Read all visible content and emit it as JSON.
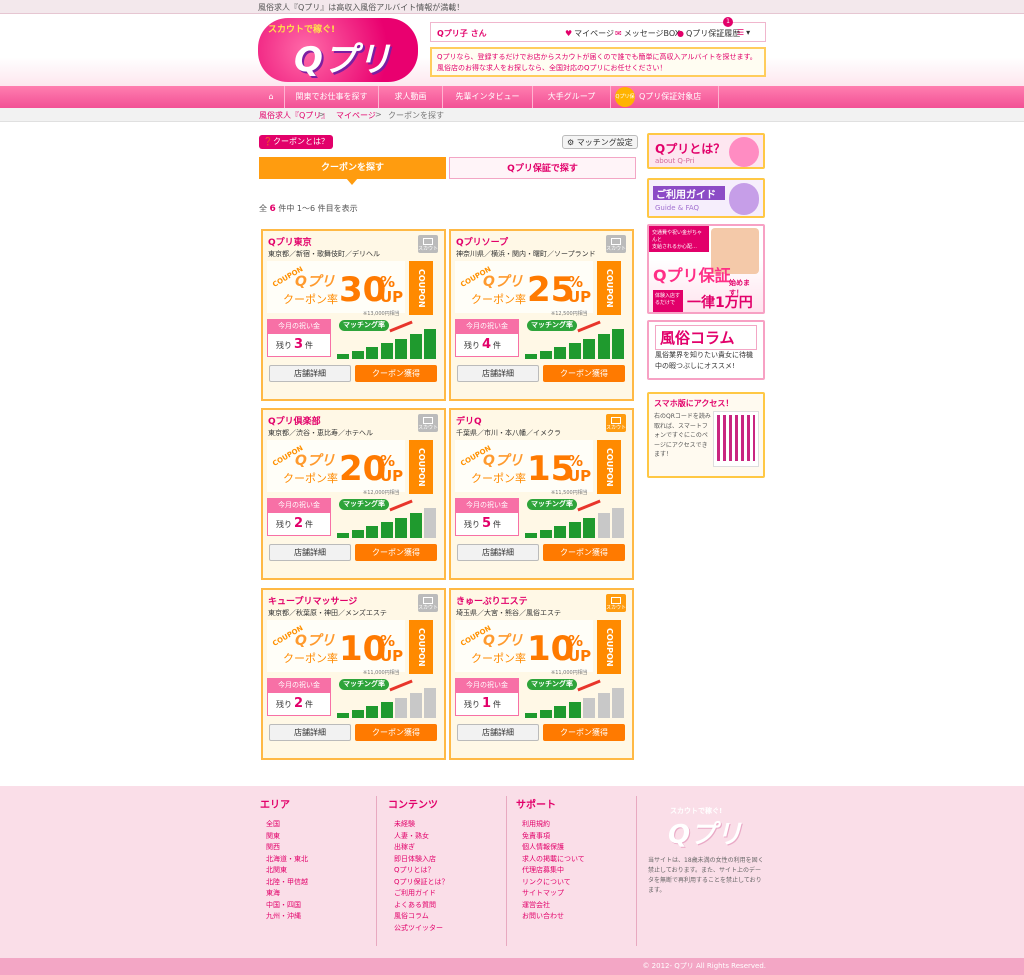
{
  "topbar": {
    "tagline": "風俗求人『Qプリ』は高収入風俗アルバイト情報が満載！"
  },
  "brand": {
    "tag": "スカウトで稼ぐ!",
    "name": "Qプリ",
    "accent": "#e2006a"
  },
  "user": {
    "name": "Qプリ子 さん",
    "links": [
      {
        "icon": "heart-icon",
        "label": "マイページ"
      },
      {
        "icon": "mail-icon",
        "label": "メッセージBOX"
      },
      {
        "icon": "lock-icon",
        "label": "Qプリ保証履歴"
      }
    ],
    "badge": "1"
  },
  "notice": "Qプリなら、登録するだけでお店からスカウトが届くので誰でも簡単に高収入アルバイトを探せます。風俗店のお得な求人をお探しなら、全国対応のQプリにお任せください！",
  "nav": {
    "home_icon": "home-icon",
    "items": [
      "関東でお仕事を探す",
      "求人動画",
      "先輩インタビュー",
      "大手グループ",
      "Qプリ保証対象店"
    ],
    "guarantee_badge": "Qプリ保証"
  },
  "breadcrumb": [
    "風俗求人『Qプリ』",
    "マイページ",
    "クーポンを探す"
  ],
  "coupon_help": "クーポンとは？",
  "matching_settings": "マッチング設定",
  "tabs": {
    "active": "クーポンを探す",
    "inactive": "Qプリ保証で探す"
  },
  "results": {
    "prefix": "全",
    "count": "6",
    "suffix": "件中 1〜6 件目を表示"
  },
  "card_labels": {
    "coupon_ribbon": "COUPON",
    "logo": "Qプリ",
    "rate_label": "クーポン率",
    "celebration": "今月の祝い金",
    "remaining": "残り",
    "unit": "件",
    "matching": "マッチング率",
    "strip": "COUPON",
    "scout": "スカウト",
    "details": "店舗詳細",
    "get": "クーポン獲得"
  },
  "cards": [
    {
      "name": "Qプリ東京",
      "area": "東京都／新宿・歌舞伎町／デリヘル",
      "rate": "30",
      "note": "※13,000円相当",
      "remaining": "3",
      "scout_active": false,
      "bars": [
        1,
        2,
        3,
        4,
        5,
        6,
        7
      ]
    },
    {
      "name": "Qプリソープ",
      "area": "神奈川県／横浜・関内・曙町／ソープランド",
      "rate": "25",
      "note": "※12,500円相当",
      "remaining": "4",
      "scout_active": false,
      "bars": [
        1,
        2,
        3,
        4,
        5,
        6,
        7
      ]
    },
    {
      "name": "Qプリ倶楽部",
      "area": "東京都／渋谷・恵比寿／ホテヘル",
      "rate": "20",
      "note": "※12,000円相当",
      "remaining": "2",
      "scout_active": false,
      "bars": [
        1,
        2,
        3,
        4,
        5,
        6,
        0
      ]
    },
    {
      "name": "デリQ",
      "area": "千葉県／市川・本八幡／イメクラ",
      "rate": "15",
      "note": "※11,500円相当",
      "remaining": "5",
      "scout_active": true,
      "bars": [
        1,
        2,
        3,
        4,
        5,
        0,
        0
      ]
    },
    {
      "name": "キュープリマッサージ",
      "area": "東京都／秋葉原・神田／メンズエステ",
      "rate": "10",
      "note": "※11,000円相当",
      "remaining": "2",
      "scout_active": false,
      "bars": [
        1,
        2,
        3,
        4,
        0,
        0,
        0
      ]
    },
    {
      "name": "きゅーぷりエステ",
      "area": "埼玉県／大宮・熊谷／風俗エステ",
      "rate": "10",
      "note": "※11,000円相当",
      "remaining": "1",
      "scout_active": true,
      "bars": [
        1,
        2,
        3,
        4,
        0,
        0,
        0
      ]
    }
  ],
  "sidebar": {
    "about": {
      "title": "Qプリとは？",
      "sub": "about Q-Pri"
    },
    "guide": {
      "title": "ご利用ガイド",
      "sub": "Guide & FAQ"
    },
    "guarantee": {
      "line1": "交通費や祝い金がちゃんと",
      "line2": "支給されるか心配…",
      "title": "Qプリ保証",
      "start": "始めます！",
      "sub": "体験入店するだけで",
      "amount": "一律1万円"
    },
    "column": {
      "title": "風俗コラム",
      "body": "風俗業界を知りたい貴女に待機中の暇つぶしにオススメ!"
    },
    "mobile": {
      "title": "スマホ版にアクセス！",
      "body": "右のQRコードを読み取れば、スマートフォンですぐにこのページにアクセスできます！"
    }
  },
  "footer": {
    "areas": {
      "title": "エリア",
      "items": [
        "全国",
        "関東",
        "関西",
        "北海道・東北",
        "北関東",
        "北陸・甲信越",
        "東海",
        "中国・四国",
        "九州・沖縄"
      ]
    },
    "contents": {
      "title": "コンテンツ",
      "items": [
        "未経験",
        "人妻・熟女",
        "出稼ぎ",
        "即日体験入店",
        "Qプリとは？",
        "Qプリ保証とは？",
        "ご利用ガイド",
        "よくある質問",
        "風俗コラム",
        "公式ツイッター"
      ]
    },
    "support": {
      "title": "サポート",
      "items": [
        "利用規約",
        "免責事項",
        "個人情報保護",
        "求人の掲載について",
        "代理店募集中",
        "リンクについて",
        "サイトマップ",
        "運営会社",
        "お問い合わせ"
      ]
    },
    "brand_tag": "スカウトで稼ぐ!",
    "brand": "Qプリ",
    "disclaimer": "当サイトは、18歳未満の女性の利用を固く禁止しております。また、サイト上のデータを無断で再利用することを禁止しております。",
    "copyright": "© 2012- Qプリ All Rights Reserved."
  }
}
